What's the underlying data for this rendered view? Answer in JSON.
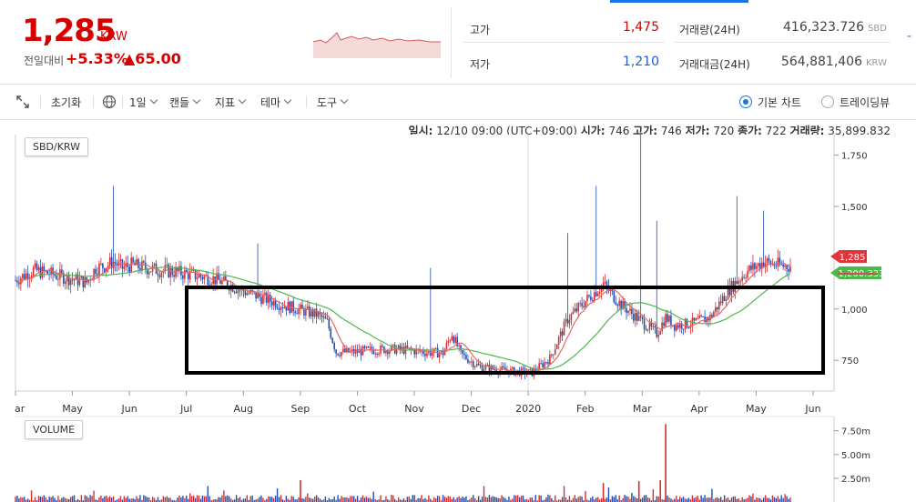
{
  "header": {
    "price": "1,285",
    "unit": "KRW",
    "change_label": "전일대비",
    "change_pct": "+5.33%",
    "change_amount": "▲65.00",
    "stats": {
      "high_label": "고가",
      "high_value": "1,475",
      "low_label": "저가",
      "low_value": "1,210",
      "volume_label": "거래량(24H)",
      "volume_value": "416,323.726",
      "volume_unit": "SBD",
      "amount_label": "거래대금(24H)",
      "amount_value": "564,881,406",
      "amount_unit": "KRW"
    },
    "colors": {
      "up": "#d60000",
      "down": "#1a5fd6",
      "accent": "#1a73e8"
    }
  },
  "toolbar": {
    "expand_icon": "expand-icon",
    "reset_label": "초기화",
    "globe_icon": "globe-icon",
    "period_label": "1일",
    "candle_label": "캔들",
    "indicator_label": "지표",
    "theme_label": "테마",
    "tools_label": "도구",
    "basic_chart_label": "기본 차트",
    "tradingview_label": "트레이딩뷰",
    "selected_chart": "basic"
  },
  "ohlc": {
    "date_label": "일시:",
    "date_value": "12/10 09:00 (UTC+09:00)",
    "open_label": "시가:",
    "open_value": "746",
    "high_label": "고가:",
    "high_value": "746",
    "low_label": "저가:",
    "low_value": "720",
    "close_label": "종가:",
    "close_value": "722",
    "volume_label": "거래량:",
    "volume_value": "35,899.832"
  },
  "chart_data": {
    "type": "candlestick",
    "pair_label": "SBD/KRW",
    "volume_label": "VOLUME",
    "x_labels": [
      "ar",
      "May",
      "Jun",
      "Jul",
      "Aug",
      "Sep",
      "Oct",
      "Nov",
      "Dec",
      "2020",
      "Feb",
      "Mar",
      "Apr",
      "May",
      "Jun"
    ],
    "y_ticks": [
      1750,
      1500,
      1250,
      1000,
      750
    ],
    "y_tick_labels": [
      "1,750",
      "1,500",
      "1,250",
      "1,000",
      "750"
    ],
    "ylim": [
      600,
      1850
    ],
    "volume_ticks": [
      "7.50m",
      "5.00m",
      "2.50m"
    ],
    "volume_tick_values": [
      7.5,
      5.0,
      2.5
    ],
    "volume_ylim": [
      0,
      9.0
    ],
    "last_price_tag": "1,285",
    "ma_tag": "1,200.333",
    "ma_colors": {
      "short": "#e8675f",
      "long": "#4cb84c"
    },
    "approx_closes": [
      [
        0,
        1140
      ],
      [
        10,
        1190
      ],
      [
        20,
        1170
      ],
      [
        30,
        1150
      ],
      [
        40,
        1130
      ],
      [
        45,
        1200
      ],
      [
        50,
        1210
      ],
      [
        55,
        1230
      ],
      [
        60,
        1200
      ],
      [
        65,
        1215
      ],
      [
        70,
        1205
      ],
      [
        80,
        1190
      ],
      [
        90,
        1180
      ],
      [
        100,
        1165
      ],
      [
        110,
        1150
      ],
      [
        120,
        1120
      ],
      [
        130,
        1080
      ],
      [
        140,
        1050
      ],
      [
        150,
        1020
      ],
      [
        160,
        995
      ],
      [
        170,
        970
      ],
      [
        175,
        935
      ],
      [
        180,
        790
      ],
      [
        190,
        790
      ],
      [
        200,
        800
      ],
      [
        210,
        805
      ],
      [
        220,
        800
      ],
      [
        230,
        790
      ],
      [
        240,
        785
      ],
      [
        245,
        880
      ],
      [
        250,
        780
      ],
      [
        260,
        720
      ],
      [
        270,
        705
      ],
      [
        280,
        695
      ],
      [
        290,
        690
      ],
      [
        300,
        760
      ],
      [
        310,
        950
      ],
      [
        320,
        1040
      ],
      [
        330,
        1120
      ],
      [
        340,
        1020
      ],
      [
        350,
        950
      ],
      [
        360,
        880
      ],
      [
        365,
        960
      ],
      [
        370,
        920
      ],
      [
        380,
        930
      ],
      [
        390,
        960
      ],
      [
        400,
        1090
      ],
      [
        410,
        1180
      ],
      [
        420,
        1230
      ],
      [
        430,
        1210
      ],
      [
        435,
        1210
      ]
    ],
    "volume_spikes": [
      [
        160,
        2.3
      ],
      [
        330,
        2.0
      ],
      [
        350,
        2.2
      ],
      [
        365,
        8.2
      ],
      [
        362,
        2.3
      ]
    ]
  },
  "annotation": {
    "highlight_rect": true,
    "highlight_color": "#000000"
  }
}
